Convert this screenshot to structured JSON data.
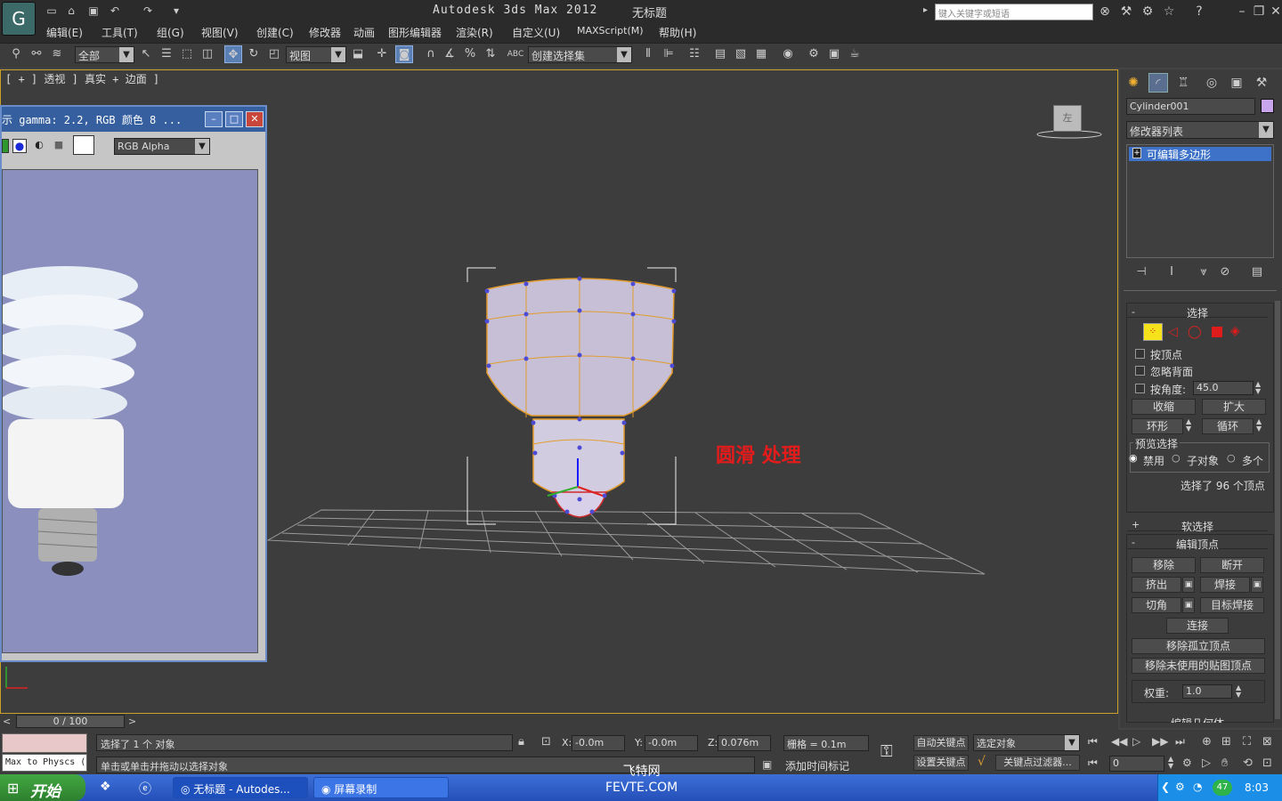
{
  "app": {
    "title": "Autodesk 3ds Max  2012",
    "doc_title": "无标题",
    "search_placeholder": "键入关键字或短语",
    "logo_icon": "3ds-max-logo-icon"
  },
  "menu": [
    "编辑(E)",
    "工具(T)",
    "组(G)",
    "视图(V)",
    "创建(C)",
    "修改器",
    "动画",
    "图形编辑器",
    "渲染(R)",
    "自定义(U)",
    "MAXScript(M)",
    "帮助(H)"
  ],
  "toolbar": {
    "filter": "全部",
    "ref_coord": "视图",
    "named_sel": "创建选择集"
  },
  "viewport": {
    "label": "[ + ] 透视 ] 真实 + 边面 ]",
    "annotation": "圆滑 处理",
    "viewcube": "左"
  },
  "frame_window": {
    "title": "示 gamma: 2.2, RGB 颜色 8 ...",
    "channel": "RGB Alpha"
  },
  "command_panel": {
    "object_name": "Cylinder001",
    "modifier_list": "修改器列表",
    "stack_item": "可编辑多边形"
  },
  "selection_rollout": {
    "title": "选择",
    "by_vertex": "按顶点",
    "ignore_backface": "忽略背面",
    "by_angle": "按角度:",
    "angle_value": "45.0",
    "shrink": "收缩",
    "grow": "扩大",
    "ring": "环形",
    "loop": "循环",
    "preview_title": "预览选择",
    "preview_disable": "禁用",
    "preview_subobject": "子对象",
    "preview_multi": "多个",
    "status": "选择了 96 个顶点"
  },
  "soft_selection": {
    "title": "软选择"
  },
  "edit_vertices": {
    "title": "编辑顶点",
    "remove": "移除",
    "break": "断开",
    "extrude": "挤出",
    "weld": "焊接",
    "chamfer": "切角",
    "target_weld": "目标焊接",
    "connect": "连接",
    "remove_isolated": "移除孤立顶点",
    "remove_unused": "移除未使用的贴图顶点",
    "weight_label": "权重:",
    "weight_value": "1.0",
    "next_rollout": "编辑几何体"
  },
  "timeline": {
    "frame": "0 / 100"
  },
  "status": {
    "script_label": "Max to Physcs (",
    "line1": "选择了 1 个 对象",
    "line2": "单击或单击并拖动以选择对象",
    "x": "-0.0m",
    "y": "-0.0m",
    "z": "0.076m",
    "grid": "栅格 = 0.1m",
    "auto_key": "自动关键点",
    "set_key": "设置关键点",
    "key_mode": "选定对象",
    "key_filter": "关键点过滤器...",
    "add_time_tag": "添加时间标记",
    "frame_field": "0"
  },
  "taskbar": {
    "start": "开始",
    "tasks": [
      "无标题 - Autodes...",
      "屏幕录制"
    ],
    "clock": "8:03",
    "tray_badge": "47"
  },
  "watermark": {
    "line1": "飞特网",
    "line2": "FEVTE.COM"
  }
}
